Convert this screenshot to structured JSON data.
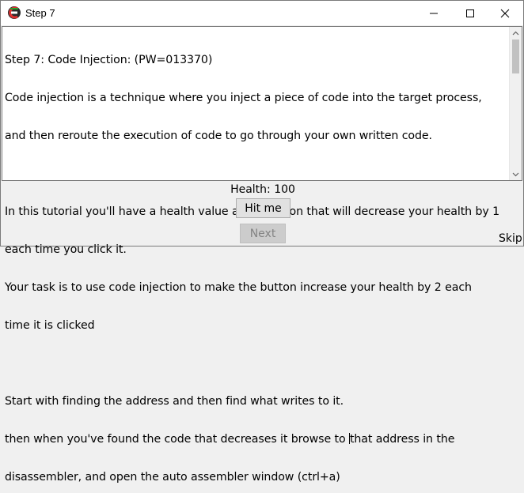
{
  "window": {
    "title": "Step 7"
  },
  "memo": {
    "lines": [
      "Step 7: Code Injection: (PW=013370)",
      "Code injection is a technique where you inject a piece of code into the target process,",
      "and then reroute the execution of code to go through your own written code.",
      "",
      "In this tutorial you'll have a health value and a button that will decrease your health by 1",
      "each time you click it.",
      "Your task is to use code injection to make the button increase your health by 2 each",
      "time it is clicked",
      "",
      "Start with finding the address and then find what writes to it.",
      "then when you've found the code that decreases it browse to ",
      "that address in the",
      "disassembler, and open the auto assembler window (ctrl+a)"
    ]
  },
  "health": {
    "text": "Health: 100"
  },
  "buttons": {
    "hit_me": "Hit me",
    "next": "Next",
    "skip": "Skip"
  },
  "colors": {
    "window_bg": "#f0f0f0",
    "memo_bg": "#ffffff",
    "button_bg": "#e1e1e1",
    "disabled_text": "#838383"
  }
}
